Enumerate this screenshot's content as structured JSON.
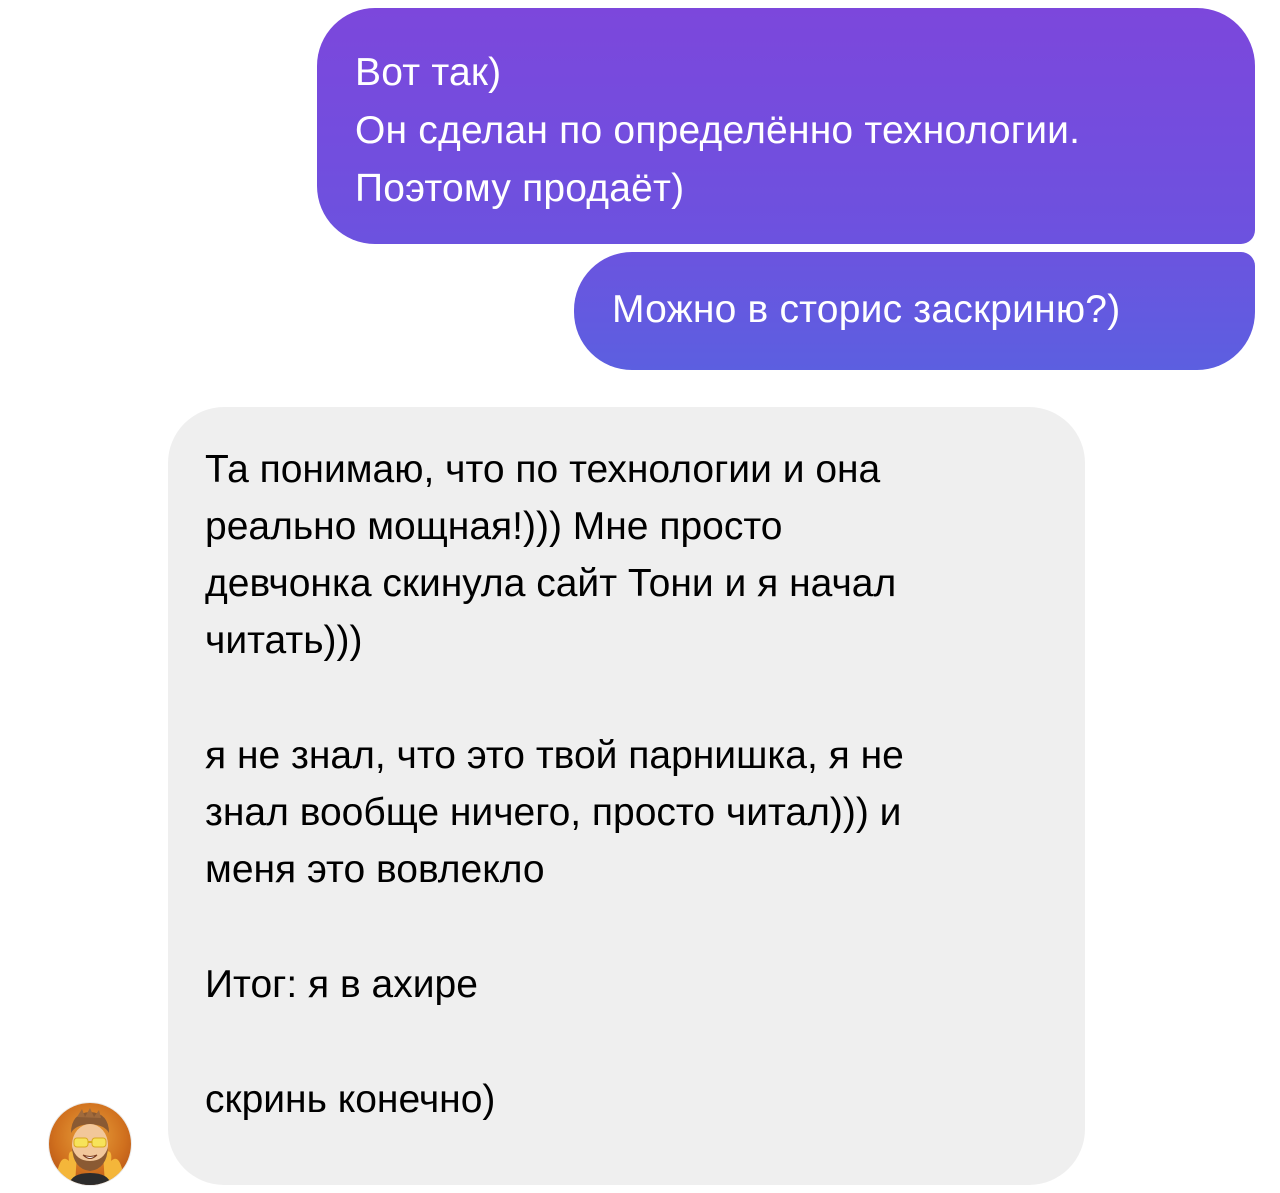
{
  "conversation": {
    "outgoing": [
      {
        "lines": [
          "Вот так)",
          "Он сделан по определённо технологии.",
          "Поэтому продаёт)"
        ]
      },
      {
        "lines": [
          "Можно в сторис заскриню?)"
        ]
      }
    ],
    "incoming": {
      "paragraphs": [
        "Та понимаю, что по технологии и она\nреально мощная!))) Мне просто\nдевчонка скинула сайт Тони и я начал\nчитать)))",
        "я не знал, что это твой парнишка, я не\nзнал вообще ничего, просто читал))) и\nменя это вовлекло",
        "Итог: я в ахире",
        "скринь конечно)"
      ]
    },
    "avatar": {
      "icon": "memoji-avatar-icon"
    }
  },
  "colors": {
    "outgoing_gradient_top": "#7c47dc",
    "outgoing_gradient_bottom": "#5c5fe0",
    "incoming_bubble": "#efefef",
    "background": "#ffffff"
  }
}
